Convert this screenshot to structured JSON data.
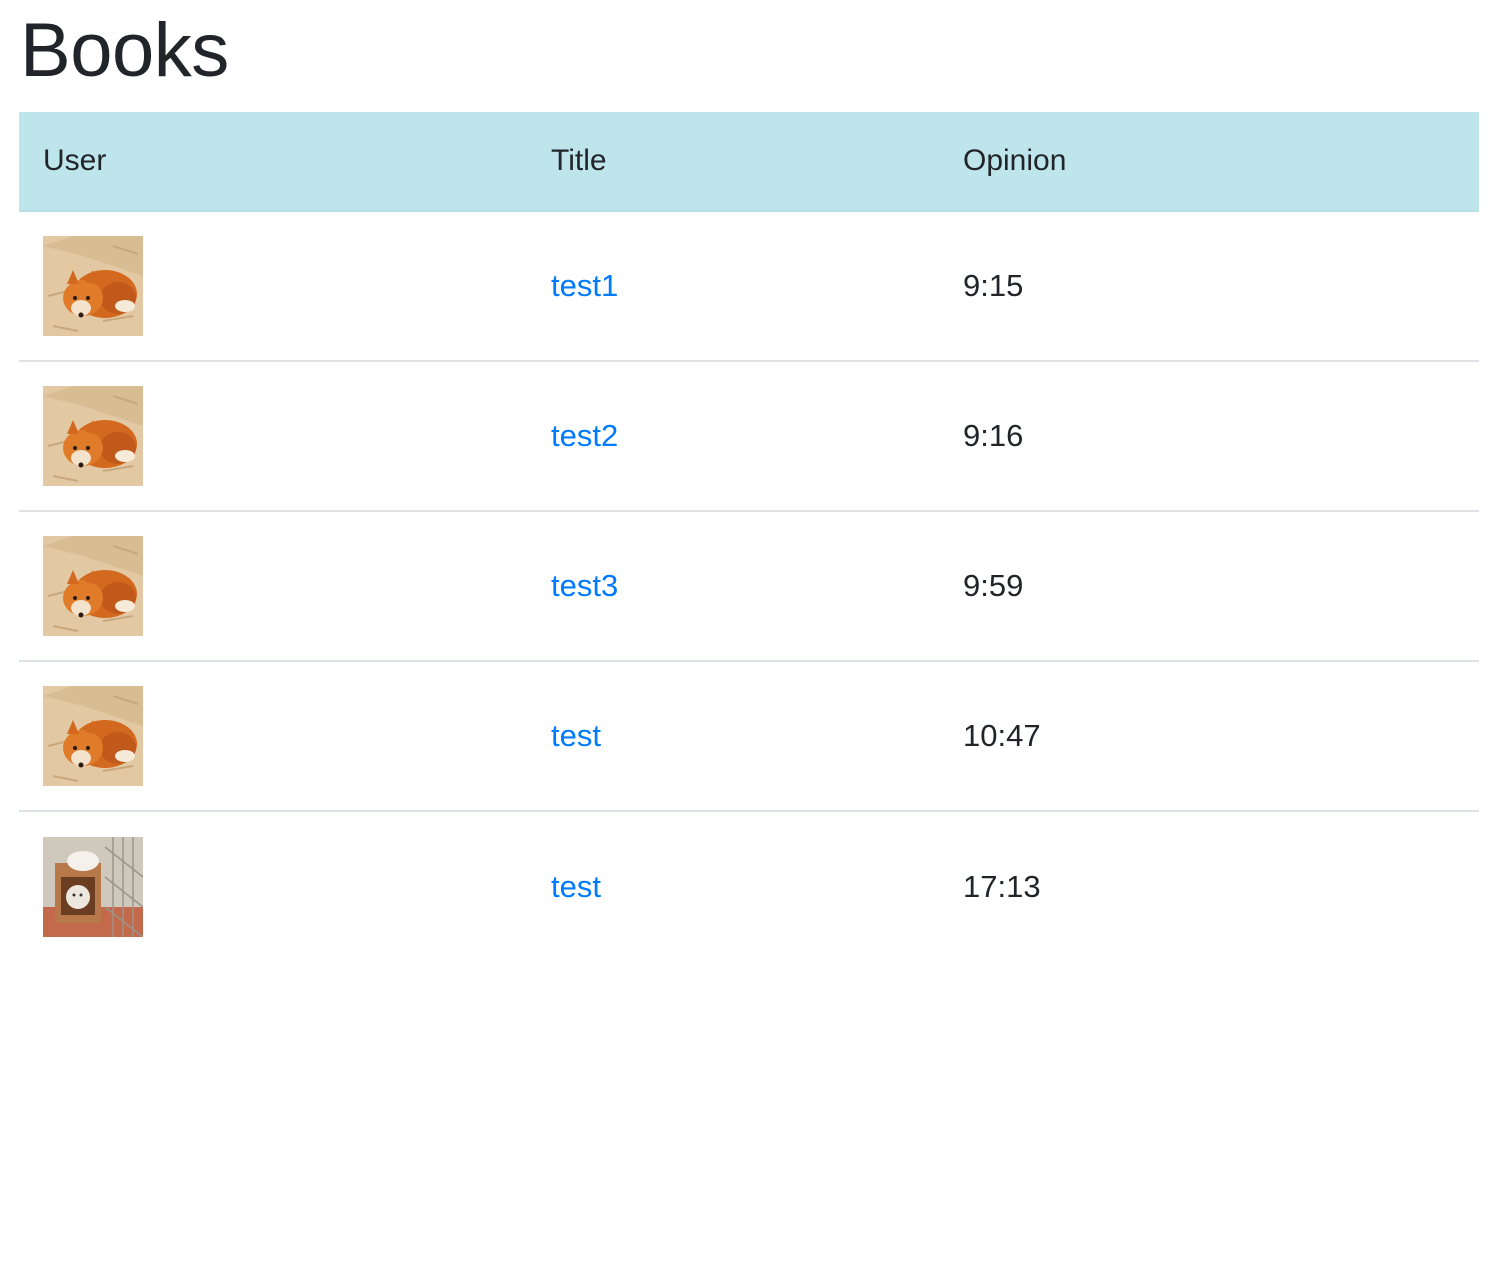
{
  "page": {
    "title": "Books"
  },
  "table": {
    "headers": {
      "user": "User",
      "title": "Title",
      "opinion": "Opinion"
    },
    "header_color": "#bee5eb",
    "link_color": "#007bff",
    "rows": [
      {
        "avatar": "fox-photo",
        "title": "test1",
        "opinion": "9:15"
      },
      {
        "avatar": "fox-photo",
        "title": "test2",
        "opinion": "9:16"
      },
      {
        "avatar": "fox-photo",
        "title": "test3",
        "opinion": "9:59"
      },
      {
        "avatar": "fox-photo",
        "title": "test",
        "opinion": "10:47"
      },
      {
        "avatar": "cat-in-cage-photo",
        "title": "test",
        "opinion": "17:13"
      }
    ]
  }
}
